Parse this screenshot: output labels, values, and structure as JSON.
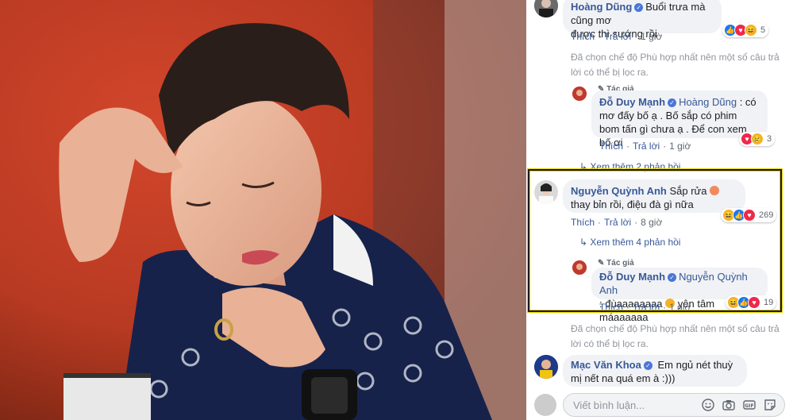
{
  "comments": {
    "hoang_dung": {
      "name": "Hoàng Dũng",
      "text_line1": "Buổi trưa mà cũng mơ",
      "text_line2": "được thì sướng rồi",
      "like": "Thích",
      "reply": "Trả lời",
      "time": "1 giờ",
      "reaction_count": "5"
    },
    "notice1": "Đã chọn chế độ Phù hợp nhất nên một số câu trả lời có thể bị lọc ra.",
    "reply1": {
      "author_tag": "Tác giả",
      "name": "Đỗ Duy Mạnh",
      "mention": "Hoàng Dũng",
      "text": ": có mơ đấy bố ạ . Bố sắp có phim bom tấn gì chưa ạ . Để con xem bố ơi",
      "like": "Thích",
      "reply": "Trả lời",
      "time": "1 giờ",
      "reaction_count": "3"
    },
    "see_more_1": "Xem thêm 2 phản hồi",
    "quynh_anh": {
      "name": "Nguyễn Quỳnh Anh",
      "text_a": "Sắp rửa",
      "text_b": "thay bỉn rồi, điệu đà gì nữa",
      "like": "Thích",
      "reply": "Trả lời",
      "time": "8 giờ",
      "reaction_count": "269"
    },
    "see_more_2": "Xem thêm 4 phản hồi",
    "reply2": {
      "author_tag": "Tác giả",
      "name": "Đỗ Duy Mạnh",
      "mention": "Nguyễn Quỳnh Anh",
      "text_a": ": đùaaaaaaaa",
      "text_b": "yên tâm máaaaaaa",
      "like": "Thích",
      "reply": "Trả lời",
      "time": "1 giờ",
      "reaction_count": "19"
    },
    "notice2": "Đã chọn chế độ Phù hợp nhất nên một số câu trả lời có thể bị lọc ra.",
    "mac_van_khoa": {
      "name": "Mạc Văn Khoa",
      "text": "Em ngủ nét thuỳ mị nết na quá em à :)))"
    }
  },
  "composer": {
    "placeholder": "Viết bình luận..."
  },
  "icons": [
    "verified-icon",
    "pencil-icon",
    "emoji-icon",
    "camera-icon",
    "gif-icon",
    "sticker-icon",
    "like-reaction-icon",
    "love-reaction-icon",
    "haha-reaction-icon",
    "sad-reaction-icon",
    "peach-emoji-icon",
    "surprised-emoji-icon",
    "reply-arrow-icon"
  ],
  "colors": {
    "link_blue": "#385898",
    "bubble_bg": "#f0f2f5",
    "highlight_border": "#e5d100"
  }
}
